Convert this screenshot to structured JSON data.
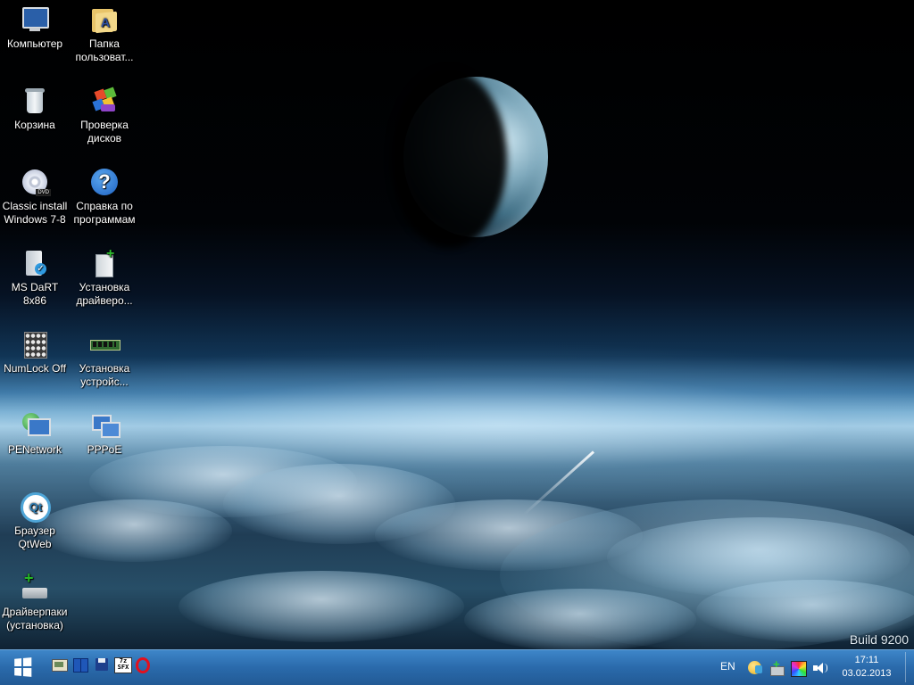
{
  "desktop": {
    "watermark": "Build 9200",
    "icons": [
      {
        "label": "Компьютер",
        "icon": "computer-icon"
      },
      {
        "label": "Папка пользоват...",
        "icon": "user-folder-icon"
      },
      {
        "label": "Корзина",
        "icon": "recycle-bin-icon"
      },
      {
        "label": "Проверка дисков",
        "icon": "disk-check-icon"
      },
      {
        "label": "Classic install Windows 7-8",
        "icon": "dvd-icon"
      },
      {
        "label": "Справка по программам",
        "icon": "help-icon"
      },
      {
        "label": "MS DaRT 8x86",
        "icon": "dart-icon"
      },
      {
        "label": "Установка драйверо...",
        "icon": "driver-install-icon"
      },
      {
        "label": "NumLock Off",
        "icon": "numlock-icon"
      },
      {
        "label": "Установка устройс...",
        "icon": "memory-module-icon"
      },
      {
        "label": "PENetwork",
        "icon": "network-icon"
      },
      {
        "label": "PPPoE",
        "icon": "pppoe-icon"
      },
      {
        "label": "Браузер QtWeb",
        "icon": "qtweb-icon"
      },
      {
        "label": "Драйверпаки (установка)",
        "icon": "driverpack-icon"
      }
    ]
  },
  "taskbar": {
    "start_icon": "windows-logo-icon",
    "pinned": [
      "explorer-icon",
      "book-icon",
      "floppy-save-icon",
      "7z-sfx-icon",
      "opera-icon"
    ],
    "sfx_text": "7z SFX",
    "language": "EN",
    "tray_icons": [
      "smiley-icon",
      "install-tray-icon",
      "color-palette-icon",
      "volume-icon"
    ],
    "clock": {
      "time": "17:11",
      "date": "03.02.2013"
    }
  },
  "colors": {
    "taskbar": "#2a6aab",
    "label_text": "#ffffff"
  }
}
